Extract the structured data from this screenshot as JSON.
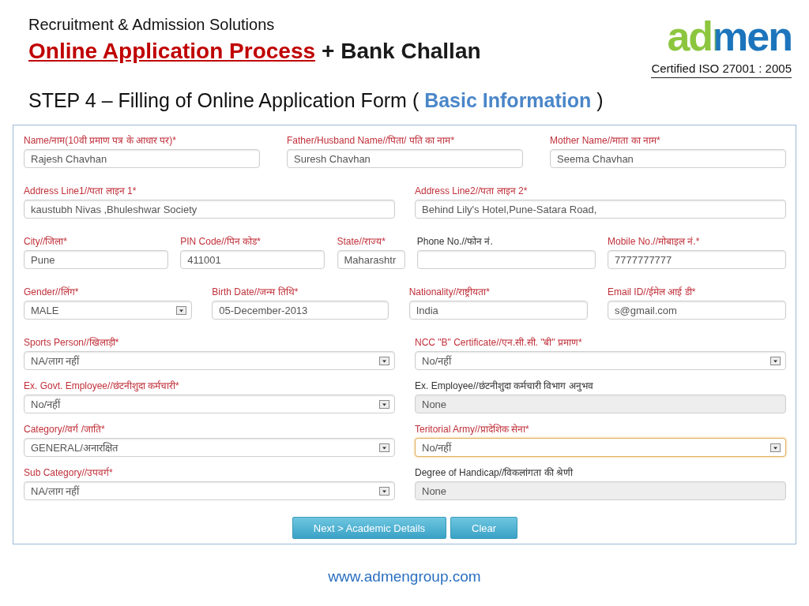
{
  "header": {
    "tagline": "Recruitment & Admission Solutions",
    "title_main": "Online Application Process",
    "title_suffix": "+ Bank Challan",
    "logo": "admen",
    "certification": "Certified ISO 27001 : 2005"
  },
  "step_heading": "STEP 4 – Filling of Online Application Form ( **Basic Information** )",
  "form": {
    "rows": [
      {
        "fields": [
          {
            "label": "Name/नाम(10वी प्रमाण पत्र के आधार पर)*",
            "value": "Rajesh Chavhan",
            "kind": "text",
            "required": true,
            "disabled": false,
            "focused": false
          },
          {
            "label": "Father/Husband Name//पिता/ पति का नाम*",
            "value": "Suresh Chavhan",
            "kind": "text",
            "required": true,
            "disabled": false,
            "focused": false
          },
          {
            "label": "Mother Name//माता का नाम*",
            "value": "Seema Chavhan",
            "kind": "text",
            "required": true,
            "disabled": false,
            "focused": false
          }
        ]
      },
      {
        "fields": [
          {
            "label": "Address Line1//पता लाइन 1*",
            "value": "kaustubh Nivas ,Bhuleshwar Society",
            "kind": "text",
            "required": true,
            "disabled": false,
            "focused": false
          },
          {
            "label": "Address Line2//पता लाइन 2*",
            "value": "Behind Lily's Hotel,Pune-Satara Road,",
            "kind": "text",
            "required": true,
            "disabled": false,
            "focused": false
          }
        ]
      },
      {
        "fields": [
          {
            "label": "City//जिला*",
            "value": "Pune",
            "kind": "text",
            "required": true,
            "disabled": false,
            "focused": false
          },
          {
            "label": "PIN Code//पिन कोड*",
            "value": "411001",
            "kind": "text",
            "required": true,
            "disabled": false,
            "focused": false
          },
          {
            "label": "State//राज्य*",
            "value": "Maharashtr",
            "kind": "text",
            "required": true,
            "disabled": false,
            "focused": false
          },
          {
            "label": "Phone No.//फोन नं.",
            "kind": "text",
            "required": false,
            "disabled": false,
            "focused": false
          },
          {
            "label": "Mobile No.//मोबाइल नं.*",
            "value": "7777777777",
            "kind": "text",
            "required": true,
            "disabled": false,
            "focused": false
          }
        ]
      },
      {
        "fields": [
          {
            "label": "Gender//लिंग*",
            "value": "MALE",
            "kind": "select",
            "required": true,
            "disabled": false,
            "focused": false
          },
          {
            "label": "Birth Date//जन्म तिथि*",
            "value": "05-December-2013",
            "kind": "text",
            "required": true,
            "disabled": false,
            "focused": false
          },
          {
            "label": "Nationality//राष्ट्रीयता*",
            "value": "India",
            "kind": "text",
            "required": true,
            "disabled": false,
            "focused": false
          },
          {
            "label": "Email ID//ईमेल आई डी*",
            "value": "s@gmail.com",
            "kind": "text",
            "required": true,
            "disabled": false,
            "focused": false
          }
        ]
      },
      {
        "fields": [
          {
            "label": "Sports Person//खिलाड़ी*",
            "value": "NA/लाग नहीं",
            "kind": "select",
            "required": true,
            "disabled": false,
            "focused": false
          },
          {
            "label": "NCC \"B\" Certificate//एन.सी.सी. \"बी\" प्रमाण*",
            "value": "No/नहीं",
            "kind": "select",
            "required": true,
            "disabled": false,
            "focused": false
          }
        ]
      },
      {
        "fields": [
          {
            "label": "Ex. Govt. Employee//छंटनीशुदा कर्मचारी*",
            "value": "No/नहीं",
            "kind": "select",
            "required": true,
            "disabled": false,
            "focused": false
          },
          {
            "label": "Ex. Employee//छंटनीशुदा कर्मचारी विभाग अनुभव",
            "value": "None",
            "kind": "text",
            "required": false,
            "disabled": true,
            "focused": false
          }
        ]
      },
      {
        "fields": [
          {
            "label": "Category//वर्ग /जाति*",
            "value": "GENERAL/अनारक्षित",
            "kind": "select",
            "required": true,
            "disabled": false,
            "focused": false
          },
          {
            "label": "Teritorial Army//प्रादेशिक सेना*",
            "value": "No/नहीं",
            "kind": "select",
            "required": true,
            "disabled": false,
            "focused": true
          }
        ]
      },
      {
        "fields": [
          {
            "label": "Sub Category//उपवर्ग*",
            "value": "NA/लाग नहीं",
            "kind": "select",
            "required": true,
            "disabled": false,
            "focused": false
          },
          {
            "label": "Degree of Handicap//विकलांगता की श्रेणी",
            "value": "None",
            "kind": "text",
            "required": false,
            "disabled": true,
            "focused": false
          }
        ]
      }
    ],
    "buttons": [
      "Next > Academic Details",
      "Clear"
    ]
  },
  "footer": {
    "website": "www.admengroup.com"
  }
}
